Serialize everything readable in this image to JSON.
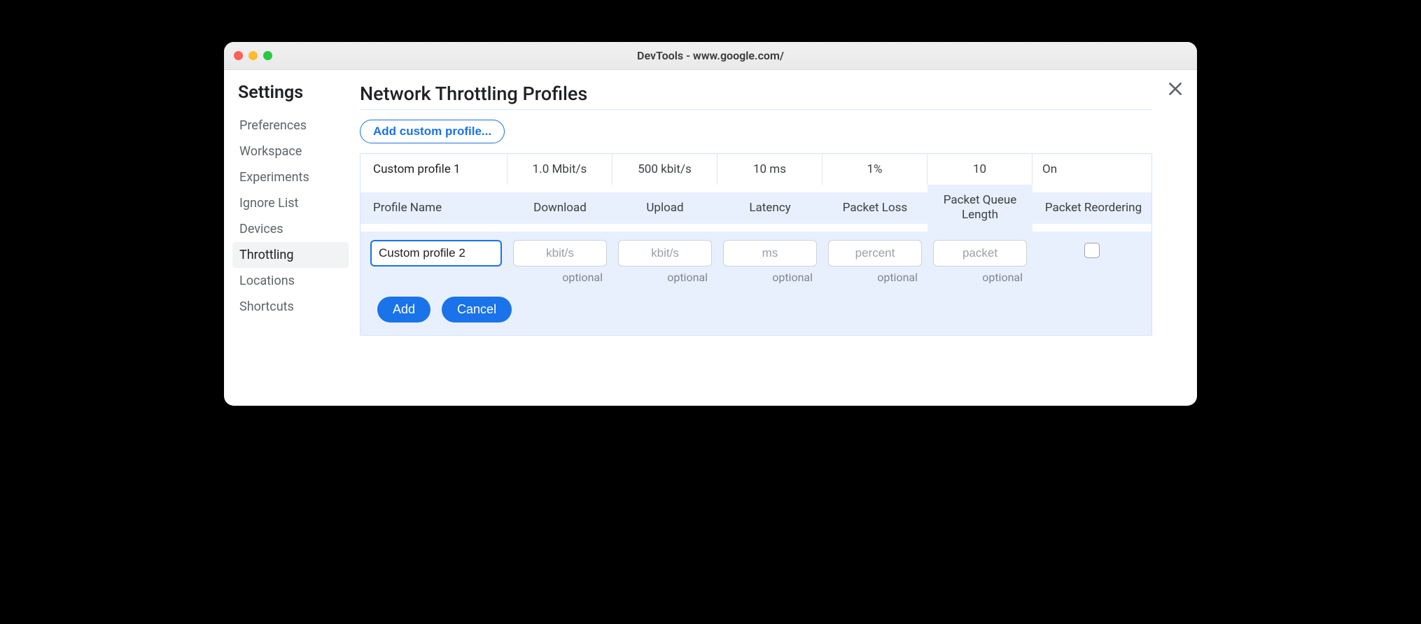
{
  "window": {
    "title": "DevTools - www.google.com/"
  },
  "sidebar": {
    "heading": "Settings",
    "items": [
      {
        "label": "Preferences",
        "selected": false
      },
      {
        "label": "Workspace",
        "selected": false
      },
      {
        "label": "Experiments",
        "selected": false
      },
      {
        "label": "Ignore List",
        "selected": false
      },
      {
        "label": "Devices",
        "selected": false
      },
      {
        "label": "Throttling",
        "selected": true
      },
      {
        "label": "Locations",
        "selected": false
      },
      {
        "label": "Shortcuts",
        "selected": false
      }
    ]
  },
  "main": {
    "heading": "Network Throttling Profiles",
    "add_button": "Add custom profile...",
    "columns": {
      "name": "Profile Name",
      "download": "Download",
      "upload": "Upload",
      "latency": "Latency",
      "loss": "Packet Loss",
      "queue": "Packet Queue Length",
      "reorder": "Packet Reordering"
    },
    "existing": {
      "name": "Custom profile 1",
      "download": "1.0 Mbit/s",
      "upload": "500 kbit/s",
      "latency": "10 ms",
      "loss": "1%",
      "queue": "10",
      "reorder": "On"
    },
    "edit": {
      "name_value": "Custom profile 2",
      "placeholders": {
        "download": "kbit/s",
        "upload": "kbit/s",
        "latency": "ms",
        "loss": "percent",
        "queue": "packet"
      },
      "optional_label": "optional",
      "reorder_checked": false,
      "add_label": "Add",
      "cancel_label": "Cancel"
    }
  }
}
